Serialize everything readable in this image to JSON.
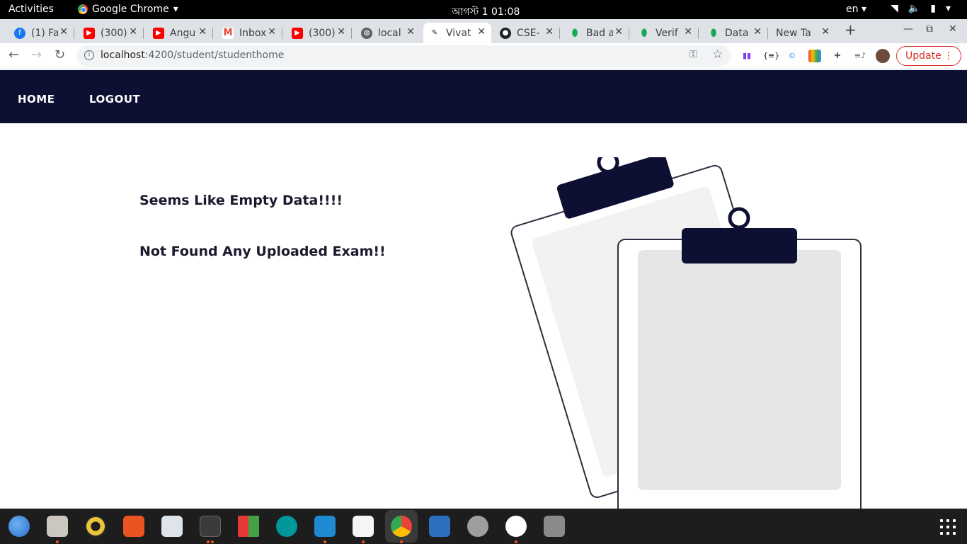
{
  "system_bar": {
    "activities": "Activities",
    "app_name": "Google Chrome",
    "clock": "আগস্ট 1  01:08",
    "language": "en"
  },
  "tabs": [
    {
      "title": "(1) Fa",
      "icon": "facebook-icon",
      "color": "#1877f2"
    },
    {
      "title": "(300)",
      "icon": "youtube-icon",
      "color": "#ff0000"
    },
    {
      "title": "Angu",
      "icon": "youtube-icon",
      "color": "#ff0000"
    },
    {
      "title": "Inbox",
      "icon": "gmail-icon",
      "color": "#ea4335"
    },
    {
      "title": "(300)",
      "icon": "youtube-icon",
      "color": "#ff0000"
    },
    {
      "title": "local",
      "icon": "globe-icon",
      "color": "#5f6368"
    },
    {
      "title": "Vivat",
      "icon": "page-icon",
      "color": "#202124"
    },
    {
      "title": "CSE-",
      "icon": "github-icon",
      "color": "#202124"
    },
    {
      "title": "Bad a",
      "icon": "mongodb-icon",
      "color": "#13aa52"
    },
    {
      "title": "Verif",
      "icon": "mongodb-icon",
      "color": "#13aa52"
    },
    {
      "title": "Data",
      "icon": "mongodb-icon",
      "color": "#13aa52"
    },
    {
      "title": "New Tab",
      "icon": "none",
      "color": "#5f6368"
    }
  ],
  "active_tab_index": 6,
  "address_bar": {
    "host": "localhost",
    "path": ":4200/student/studenthome"
  },
  "update_button": "Update",
  "app_nav": {
    "home": "HOME",
    "logout": "LOGOUT"
  },
  "content": {
    "empty_message": "Seems Like Empty Data!!!!",
    "not_found_message": "Not Found Any Uploaded Exam!!"
  },
  "colors": {
    "navbar_bg": "#0d0f33",
    "accent_dark": "#0d0f33"
  },
  "dock_icons": [
    "thunderbird-icon",
    "files-icon",
    "rhythmbox-icon",
    "software-center-icon",
    "screen-reader-icon",
    "terminal-icon",
    "winapp-icon",
    "arduino-icon",
    "vscode-icon",
    "text-editor-icon",
    "chrome-icon",
    "document-viewer-icon",
    "settings-icon",
    "mongodb-compass-icon",
    "disk-icon"
  ]
}
